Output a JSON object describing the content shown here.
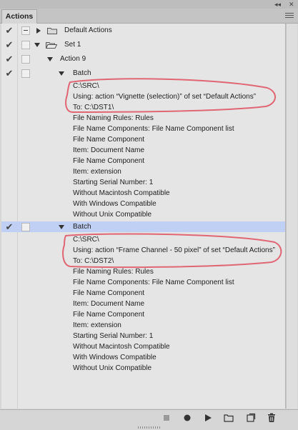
{
  "panel": {
    "tab_label": "Actions",
    "top_controls": "◂◂ ✕"
  },
  "rows": {
    "default_actions": "Default Actions",
    "set1": "Set 1",
    "action9": "Action 9",
    "batch1": {
      "title": "Batch",
      "lines": [
        "C:\\SRC\\",
        "Using: action “Vignette (selection)” of set “Default Actions”",
        "To: C:\\DST1\\",
        "File Naming Rules: Rules",
        "File Name Components: File Name Component list",
        "File Name Component",
        "Item: Document Name",
        "File Name Component",
        "Item: extension",
        "Starting Serial Number: 1",
        "Without Macintosh Compatible",
        "With Windows Compatible",
        "Without Unix Compatible"
      ]
    },
    "batch2": {
      "title": "Batch",
      "lines": [
        "C:\\SRC\\",
        "Using: action “Frame Channel - 50 pixel” of set “Default Actions”",
        "To: C:\\DST2\\",
        "File Naming Rules: Rules",
        "File Name Components: File Name Component list",
        "File Name Component",
        "Item: Document Name",
        "File Name Component",
        "Item: extension",
        "Starting Serial Number: 1",
        "Without Macintosh Compatible",
        "With Windows Compatible",
        "Without Unix Compatible"
      ]
    }
  },
  "icons": {
    "check": "✔",
    "bottom_bar": [
      "stop-icon",
      "record-icon",
      "play-icon",
      "new-set-icon",
      "new-action-icon",
      "delete-icon"
    ]
  },
  "colors": {
    "selection": "#c0cff4",
    "annotation": "#e05060"
  }
}
